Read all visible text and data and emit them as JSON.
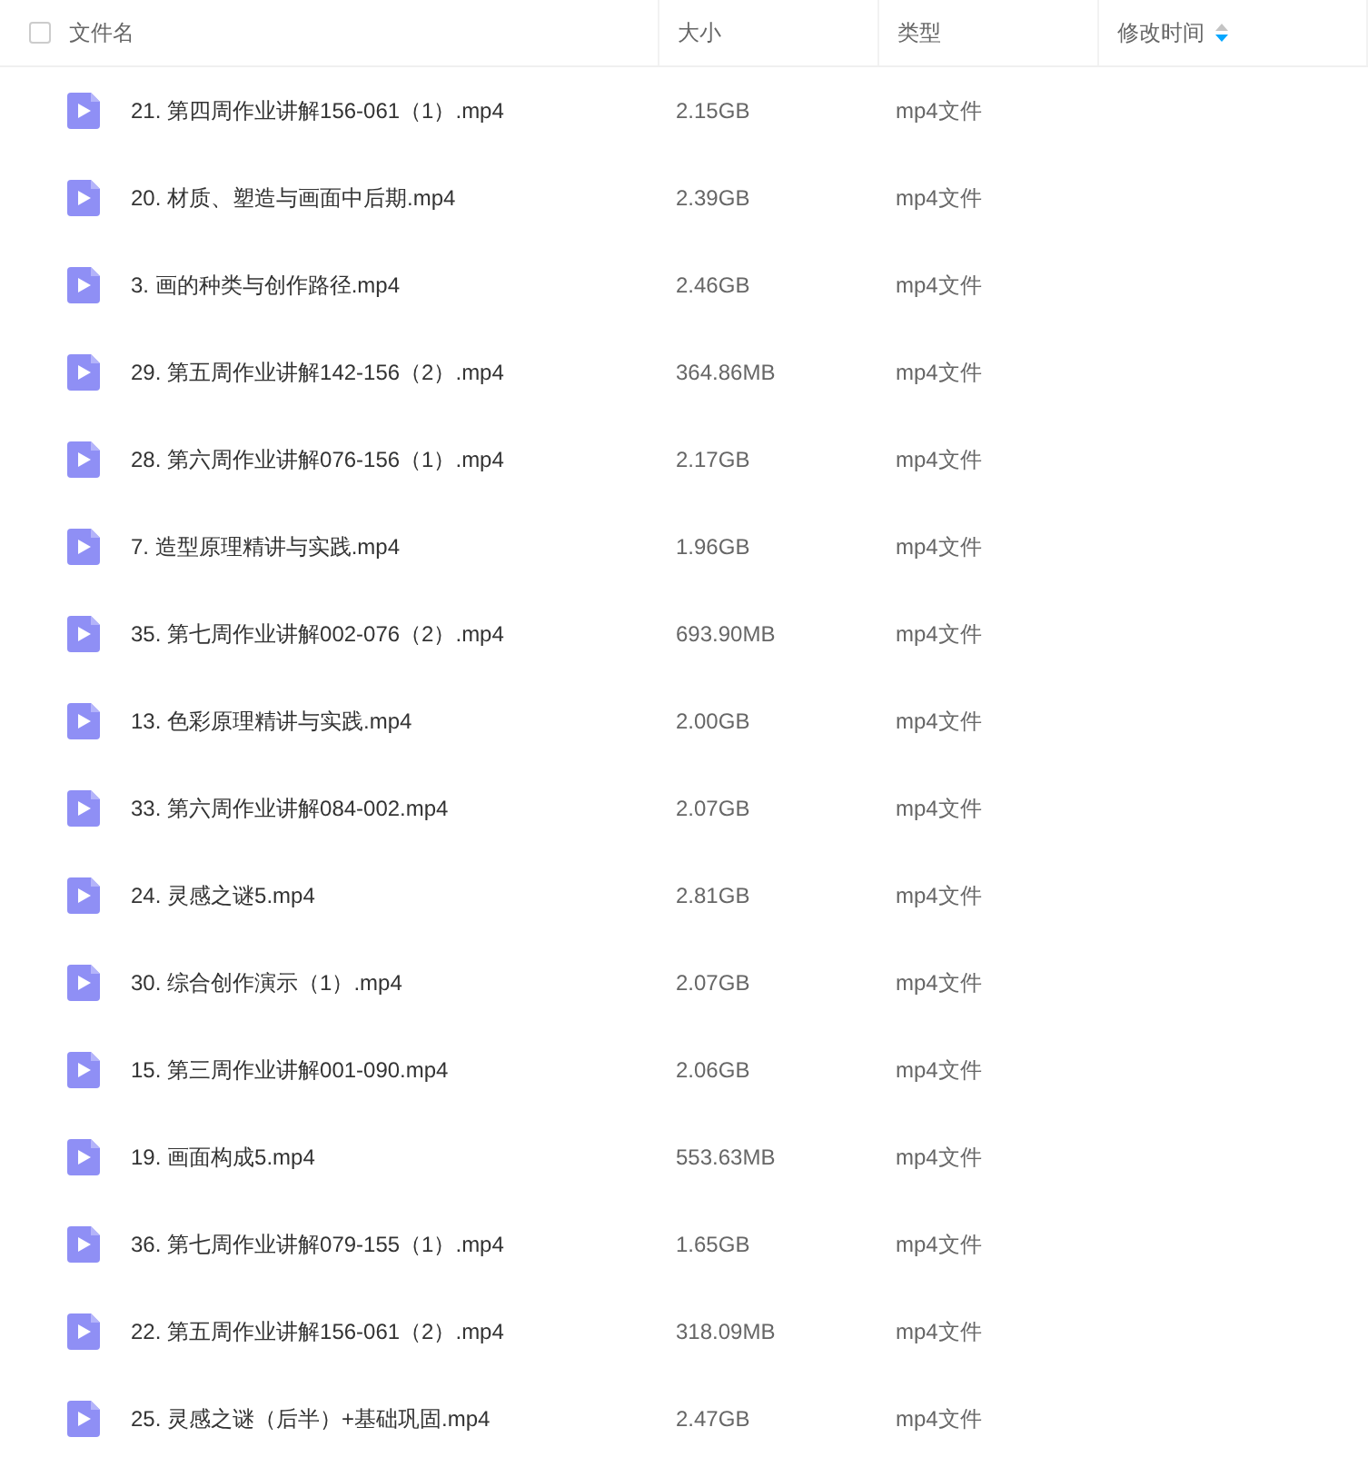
{
  "header": {
    "select_all": {
      "checked": false
    },
    "columns": [
      {
        "label": "文件名",
        "sorted": false
      },
      {
        "label": "大小",
        "sorted": false
      },
      {
        "label": "类型",
        "sorted": false
      },
      {
        "label": "修改时间",
        "sorted": true
      }
    ]
  },
  "files": [
    {
      "name": "21. 第四周作业讲解156-061（1）.mp4",
      "size": "2.15GB",
      "type": "mp4文件"
    },
    {
      "name": "20. 材质、塑造与画面中后期.mp4",
      "size": "2.39GB",
      "type": "mp4文件"
    },
    {
      "name": "3. 画的种类与创作路径.mp4",
      "size": "2.46GB",
      "type": "mp4文件"
    },
    {
      "name": "29. 第五周作业讲解142-156（2）.mp4",
      "size": "364.86MB",
      "type": "mp4文件"
    },
    {
      "name": "28. 第六周作业讲解076-156（1）.mp4",
      "size": "2.17GB",
      "type": "mp4文件"
    },
    {
      "name": "7. 造型原理精讲与实践.mp4",
      "size": "1.96GB",
      "type": "mp4文件"
    },
    {
      "name": "35. 第七周作业讲解002-076（2）.mp4",
      "size": "693.90MB",
      "type": "mp4文件"
    },
    {
      "name": "13. 色彩原理精讲与实践.mp4",
      "size": "2.00GB",
      "type": "mp4文件"
    },
    {
      "name": "33. 第六周作业讲解084-002.mp4",
      "size": "2.07GB",
      "type": "mp4文件"
    },
    {
      "name": "24. 灵感之谜5.mp4",
      "size": "2.81GB",
      "type": "mp4文件"
    },
    {
      "name": "30. 综合创作演示（1）.mp4",
      "size": "2.07GB",
      "type": "mp4文件"
    },
    {
      "name": "15. 第三周作业讲解001-090.mp4",
      "size": "2.06GB",
      "type": "mp4文件"
    },
    {
      "name": "19. 画面构成5.mp4",
      "size": "553.63MB",
      "type": "mp4文件"
    },
    {
      "name": "36. 第七周作业讲解079-155（1）.mp4",
      "size": "1.65GB",
      "type": "mp4文件"
    },
    {
      "name": "22. 第五周作业讲解156-061（2）.mp4",
      "size": "318.09MB",
      "type": "mp4文件"
    },
    {
      "name": "25. 灵感之谜（后半）+基础巩固.mp4",
      "size": "2.47GB",
      "type": "mp4文件"
    }
  ]
}
